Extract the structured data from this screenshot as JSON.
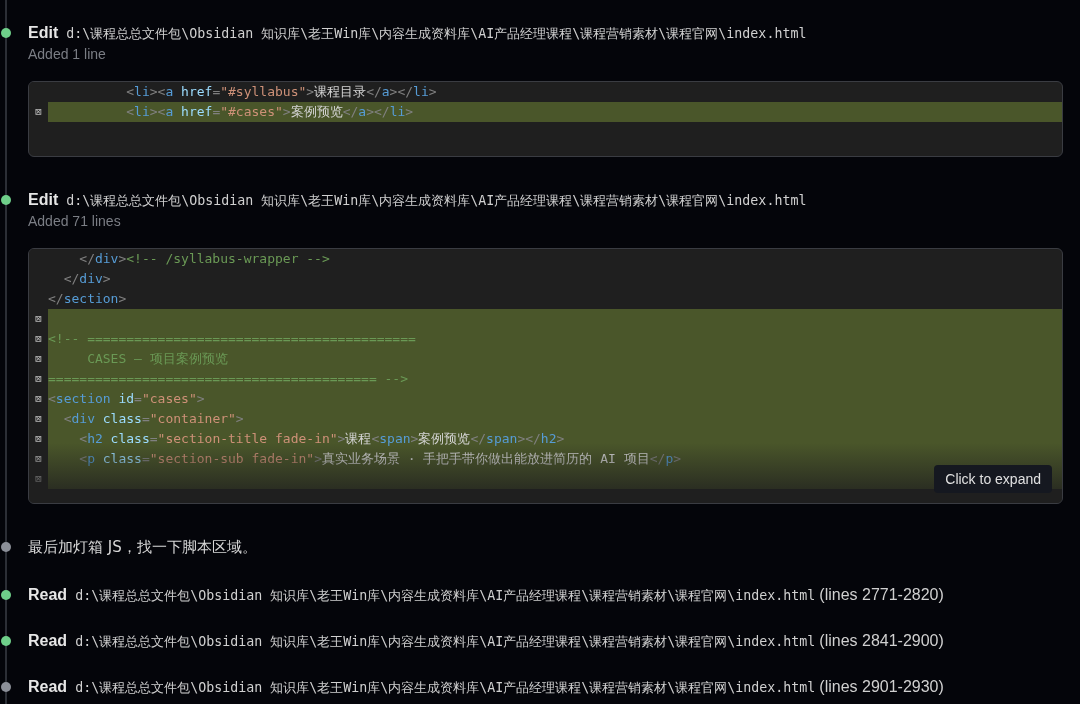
{
  "entries": [
    {
      "kind": "edit",
      "color": "#6fcf8a",
      "action": "Edit",
      "path": "d:\\课程总总文件包\\Obsidian 知识库\\老王Win库\\内容生成资料库\\AI产品经理课程\\课程营销素材\\课程官网\\index.html",
      "summary": "Added 1 line",
      "diff": {
        "collapsed": false,
        "lines": [
          {
            "added": false,
            "tokens": [
              {
                "kind": "punct",
                "text": "          <"
              },
              {
                "kind": "tag",
                "text": "li"
              },
              {
                "kind": "punct",
                "text": "><"
              },
              {
                "kind": "tag",
                "text": "a"
              },
              {
                "kind": "attr",
                "text": " href"
              },
              {
                "kind": "punct",
                "text": "="
              },
              {
                "kind": "string",
                "text": "\"#syllabus\""
              },
              {
                "kind": "punct",
                "text": ">"
              },
              {
                "kind": "text",
                "text": "课程目录"
              },
              {
                "kind": "punct",
                "text": "</"
              },
              {
                "kind": "tag",
                "text": "a"
              },
              {
                "kind": "punct",
                "text": "></"
              },
              {
                "kind": "tag",
                "text": "li"
              },
              {
                "kind": "punct",
                "text": ">"
              }
            ]
          },
          {
            "added": true,
            "marker": "⊠",
            "tokens": [
              {
                "kind": "punct",
                "text": "          <"
              },
              {
                "kind": "tag",
                "text": "li"
              },
              {
                "kind": "punct",
                "text": "><"
              },
              {
                "kind": "tag",
                "text": "a"
              },
              {
                "kind": "attr",
                "text": " href"
              },
              {
                "kind": "punct",
                "text": "="
              },
              {
                "kind": "string",
                "text": "\"#cases\""
              },
              {
                "kind": "punct",
                "text": ">"
              },
              {
                "kind": "text",
                "text": "案例预览"
              },
              {
                "kind": "punct",
                "text": "</"
              },
              {
                "kind": "tag",
                "text": "a"
              },
              {
                "kind": "punct",
                "text": "></"
              },
              {
                "kind": "tag",
                "text": "li"
              },
              {
                "kind": "punct",
                "text": ">"
              }
            ]
          }
        ]
      }
    },
    {
      "kind": "edit",
      "color": "#6fcf8a",
      "action": "Edit",
      "path": "d:\\课程总总文件包\\Obsidian 知识库\\老王Win库\\内容生成资料库\\AI产品经理课程\\课程营销素材\\课程官网\\index.html",
      "summary": "Added 71 lines",
      "diff": {
        "collapsed": true,
        "expand_label": "Click to expand",
        "lines": [
          {
            "added": false,
            "tokens": [
              {
                "kind": "punct",
                "text": "    </"
              },
              {
                "kind": "tag",
                "text": "div"
              },
              {
                "kind": "punct",
                "text": ">"
              },
              {
                "kind": "comment",
                "text": "<!-- /syllabus-wrapper -->"
              }
            ]
          },
          {
            "added": false,
            "tokens": [
              {
                "kind": "punct",
                "text": "  </"
              },
              {
                "kind": "tag",
                "text": "div"
              },
              {
                "kind": "punct",
                "text": ">"
              }
            ]
          },
          {
            "added": false,
            "tokens": [
              {
                "kind": "punct",
                "text": "</"
              },
              {
                "kind": "tag",
                "text": "section"
              },
              {
                "kind": "punct",
                "text": ">"
              }
            ]
          },
          {
            "added": true,
            "marker": "⊠"
          },
          {
            "added": true,
            "marker": "⊠",
            "tokens": [
              {
                "kind": "comment",
                "text": "<!-- =========================================="
              }
            ]
          },
          {
            "added": true,
            "marker": "⊠",
            "tokens": [
              {
                "kind": "comment",
                "text": "     CASES — 项目案例预览"
              }
            ]
          },
          {
            "added": true,
            "marker": "⊠",
            "tokens": [
              {
                "kind": "comment",
                "text": "========================================== -->"
              }
            ]
          },
          {
            "added": true,
            "marker": "⊠",
            "tokens": [
              {
                "kind": "punct",
                "text": "<"
              },
              {
                "kind": "tag",
                "text": "section"
              },
              {
                "kind": "attr",
                "text": " id"
              },
              {
                "kind": "punct",
                "text": "="
              },
              {
                "kind": "string",
                "text": "\"cases\""
              },
              {
                "kind": "punct",
                "text": ">"
              }
            ]
          },
          {
            "added": true,
            "marker": "⊠",
            "tokens": [
              {
                "kind": "punct",
                "text": "  <"
              },
              {
                "kind": "tag",
                "text": "div"
              },
              {
                "kind": "attr",
                "text": " class"
              },
              {
                "kind": "punct",
                "text": "="
              },
              {
                "kind": "string",
                "text": "\"container\""
              },
              {
                "kind": "punct",
                "text": ">"
              }
            ]
          },
          {
            "added": true,
            "marker": "⊠",
            "tokens": [
              {
                "kind": "punct",
                "text": "    <"
              },
              {
                "kind": "tag",
                "text": "h2"
              },
              {
                "kind": "attr",
                "text": " class"
              },
              {
                "kind": "punct",
                "text": "="
              },
              {
                "kind": "string",
                "text": "\"section-title fade-in\""
              },
              {
                "kind": "punct",
                "text": ">"
              },
              {
                "kind": "text",
                "text": "课程"
              },
              {
                "kind": "punct",
                "text": "<"
              },
              {
                "kind": "tag",
                "text": "span"
              },
              {
                "kind": "punct",
                "text": ">"
              },
              {
                "kind": "text",
                "text": "案例预览"
              },
              {
                "kind": "punct",
                "text": "</"
              },
              {
                "kind": "tag",
                "text": "span"
              },
              {
                "kind": "punct",
                "text": "></"
              },
              {
                "kind": "tag",
                "text": "h2"
              },
              {
                "kind": "punct",
                "text": ">"
              }
            ]
          },
          {
            "added": true,
            "marker": "⊠",
            "tokens": [
              {
                "kind": "punct",
                "text": "    <"
              },
              {
                "kind": "tag",
                "text": "p"
              },
              {
                "kind": "attr",
                "text": " class"
              },
              {
                "kind": "punct",
                "text": "="
              },
              {
                "kind": "string",
                "text": "\"section-sub fade-in\""
              },
              {
                "kind": "punct",
                "text": ">"
              },
              {
                "kind": "text",
                "text": "真实业务场景 · 手把手带你做出能放进简历的 AI 项目"
              },
              {
                "kind": "punct",
                "text": "</"
              },
              {
                "kind": "tag",
                "text": "p"
              },
              {
                "kind": "punct",
                "text": ">"
              }
            ]
          },
          {
            "added": true,
            "marker": "⊠"
          }
        ]
      }
    },
    {
      "kind": "message",
      "color": "#8b8f98",
      "text": "最后加灯箱 JS，找一下脚本区域。"
    },
    {
      "kind": "read",
      "color": "#6fcf8a",
      "action": "Read",
      "path": "d:\\课程总总文件包\\Obsidian 知识库\\老王Win库\\内容生成资料库\\AI产品经理课程\\课程营销素材\\课程官网\\index.html",
      "range": "(lines 2771-2820)"
    },
    {
      "kind": "read",
      "color": "#6fcf8a",
      "action": "Read",
      "path": "d:\\课程总总文件包\\Obsidian 知识库\\老王Win库\\内容生成资料库\\AI产品经理课程\\课程营销素材\\课程官网\\index.html",
      "range": "(lines 2841-2900)"
    },
    {
      "kind": "read",
      "color": "#8b8f98",
      "action": "Read",
      "path": "d:\\课程总总文件包\\Obsidian 知识库\\老王Win库\\内容生成资料库\\AI产品经理课程\\课程营销素材\\课程官网\\index.html",
      "range": "(lines 2901-2930)"
    }
  ]
}
